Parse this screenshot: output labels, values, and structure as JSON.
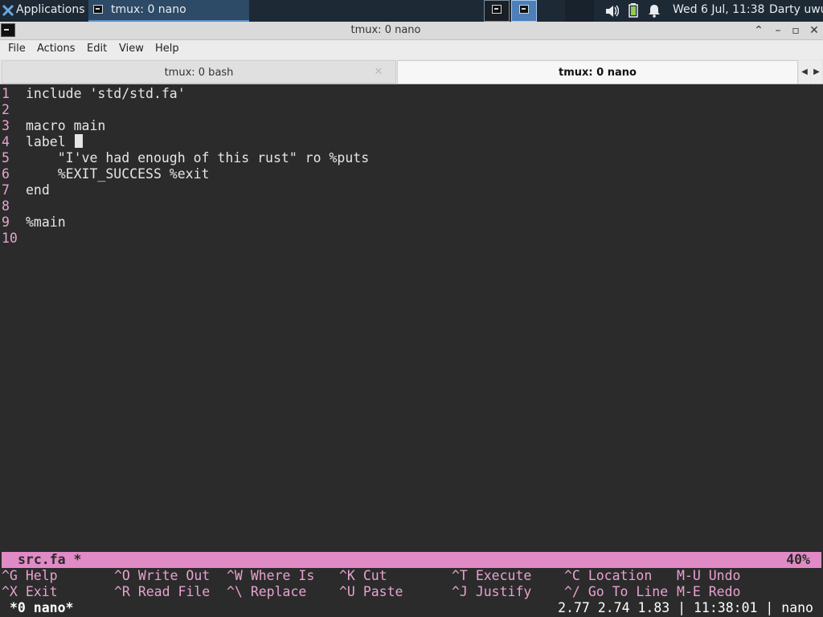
{
  "panel": {
    "applications_label": "Applications",
    "task_label": "tmux: 0 nano",
    "clock": "Wed  6 Jul, 11:38",
    "user": "Darty uwu"
  },
  "window": {
    "title": "tmux: 0 nano",
    "menu": [
      "File",
      "Actions",
      "Edit",
      "View",
      "Help"
    ],
    "tabs": [
      {
        "label": "tmux: 0 bash",
        "active": false
      },
      {
        "label": "tmux: 0 nano",
        "active": true
      }
    ]
  },
  "editor": {
    "lines": [
      {
        "num": "1",
        "text": "include 'std/std.fa'"
      },
      {
        "num": "2",
        "text": ""
      },
      {
        "num": "3",
        "text": "macro main"
      },
      {
        "num": "4",
        "text": "label "
      },
      {
        "num": "5",
        "text": "    \"I've had enough of this rust\" ro %puts"
      },
      {
        "num": "6",
        "text": "    %EXIT_SUCCESS %exit"
      },
      {
        "num": "7",
        "text": "end"
      },
      {
        "num": "8",
        "text": ""
      },
      {
        "num": "9",
        "text": "%main"
      },
      {
        "num": "10",
        "text": ""
      }
    ],
    "status_file": "src.fa *",
    "status_percent": "40%",
    "shortcuts_row1": [
      {
        "key": "^G",
        "desc": "Help"
      },
      {
        "key": "^O",
        "desc": "Write Out"
      },
      {
        "key": "^W",
        "desc": "Where Is"
      },
      {
        "key": "^K",
        "desc": "Cut"
      },
      {
        "key": "^T",
        "desc": "Execute"
      },
      {
        "key": "^C",
        "desc": "Location"
      },
      {
        "key": "M-U",
        "desc": "Undo"
      }
    ],
    "shortcuts_row2": [
      {
        "key": "^X",
        "desc": "Exit"
      },
      {
        "key": "^R",
        "desc": "Read File"
      },
      {
        "key": "^\\",
        "desc": "Replace"
      },
      {
        "key": "^U",
        "desc": "Paste"
      },
      {
        "key": "^J",
        "desc": "Justify"
      },
      {
        "key": "^/",
        "desc": "Go To Line"
      },
      {
        "key": "M-E",
        "desc": "Redo"
      }
    ]
  },
  "tmux": {
    "window": "*0 nano*",
    "status_right": "2.77 2.74 1.83 | 11:38:01 | nano"
  },
  "colors": {
    "accent_pink": "#e08ac6",
    "line_number": "#e8a2d0",
    "terminal_bg": "#2b2b2b",
    "panel_bg": "#1d2935"
  }
}
